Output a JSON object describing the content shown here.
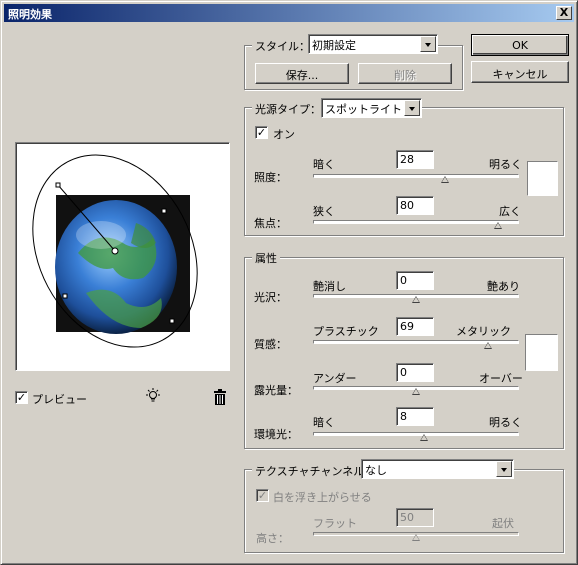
{
  "window": {
    "title": "照明効果",
    "close": "X"
  },
  "buttons": {
    "ok": "OK",
    "cancel": "キャンセル",
    "save": "保存...",
    "delete": "削除"
  },
  "style": {
    "label": "スタイル：",
    "value": "初期設定"
  },
  "light_type": {
    "label": "光源タイプ：",
    "value": "スポットライト",
    "on_label": "オン",
    "on_checked": "✓",
    "intensity": {
      "label": "照度：",
      "min": "暗く",
      "max": "明るく",
      "value": "28",
      "level": 0.64
    },
    "focus": {
      "label": "焦点：",
      "min": "狭く",
      "max": "広く",
      "value": "80",
      "level": 0.9
    }
  },
  "properties": {
    "label": "属性",
    "gloss": {
      "label": "光沢：",
      "min": "艶消し",
      "max": "艶あり",
      "value": "0",
      "level": 0.5
    },
    "material": {
      "label": "質感：",
      "min": "プラスチック",
      "max": "メタリック",
      "value": "69",
      "level": 0.85
    },
    "exposure": {
      "label": "露光量：",
      "min": "アンダー",
      "max": "オーバー",
      "value": "0",
      "level": 0.5
    },
    "ambience": {
      "label": "環境光：",
      "min": "暗く",
      "max": "明るく",
      "value": "8",
      "level": 0.54
    }
  },
  "texture": {
    "label": "テクスチャチャンネル：",
    "value": "なし",
    "white_high_label": "白を浮き上がらせる",
    "white_high_checked": "✓",
    "height": {
      "label": "高さ：",
      "min": "フラット",
      "max": "起伏",
      "value": "50",
      "level": 0.5
    }
  },
  "preview": {
    "label": "プレビュー",
    "checked": "✓"
  },
  "icons": {
    "light": "lightbulb-icon",
    "trash": "trash-icon"
  },
  "colors": {
    "title_start": "#0a246a",
    "title_end": "#a6caf0",
    "dialog": "#d4d0c8"
  }
}
